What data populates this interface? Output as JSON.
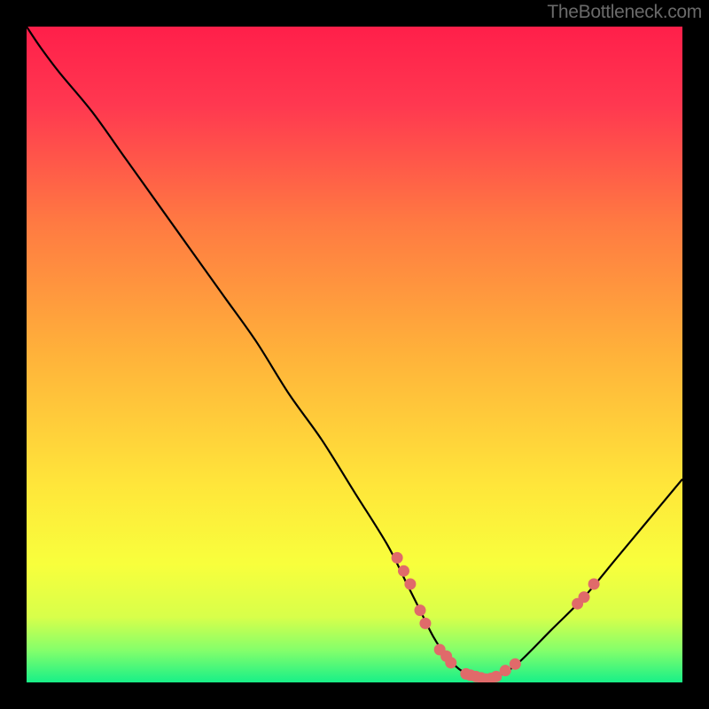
{
  "watermark": "TheBottleneck.com",
  "chart_data": {
    "type": "line",
    "title": "",
    "xlabel": "",
    "ylabel": "",
    "xlim": [
      0,
      100
    ],
    "ylim": [
      0,
      100
    ],
    "curve": {
      "x": [
        0,
        2,
        5,
        10,
        15,
        20,
        25,
        30,
        35,
        40,
        45,
        50,
        55,
        58,
        60,
        62,
        64,
        66,
        68,
        70,
        72,
        75,
        80,
        85,
        90,
        95,
        100
      ],
      "y": [
        100,
        97,
        93,
        87,
        80,
        73,
        66,
        59,
        52,
        44,
        37,
        29,
        21,
        15,
        11,
        7,
        4,
        2,
        1,
        0.5,
        1,
        3,
        8,
        13,
        19,
        25,
        31
      ]
    },
    "highlight_points": [
      {
        "x": 56.5,
        "y": 19
      },
      {
        "x": 57.5,
        "y": 17
      },
      {
        "x": 58.5,
        "y": 15
      },
      {
        "x": 60.0,
        "y": 11
      },
      {
        "x": 60.8,
        "y": 9
      },
      {
        "x": 63.0,
        "y": 5
      },
      {
        "x": 64.0,
        "y": 4
      },
      {
        "x": 64.7,
        "y": 3
      },
      {
        "x": 67.0,
        "y": 1.3
      },
      {
        "x": 67.7,
        "y": 1.1
      },
      {
        "x": 68.5,
        "y": 0.9
      },
      {
        "x": 69.3,
        "y": 0.7
      },
      {
        "x": 70.0,
        "y": 0.5
      },
      {
        "x": 70.8,
        "y": 0.6
      },
      {
        "x": 71.6,
        "y": 0.9
      },
      {
        "x": 73.0,
        "y": 1.8
      },
      {
        "x": 74.5,
        "y": 2.8
      },
      {
        "x": 84.0,
        "y": 12
      },
      {
        "x": 85.0,
        "y": 13
      },
      {
        "x": 86.5,
        "y": 15
      }
    ],
    "gradient_stops": [
      {
        "offset": 0.0,
        "color": "#ff1f4a"
      },
      {
        "offset": 0.12,
        "color": "#ff3850"
      },
      {
        "offset": 0.3,
        "color": "#ff7a42"
      },
      {
        "offset": 0.5,
        "color": "#ffb23a"
      },
      {
        "offset": 0.7,
        "color": "#ffe63a"
      },
      {
        "offset": 0.82,
        "color": "#f8ff3c"
      },
      {
        "offset": 0.9,
        "color": "#d8ff4a"
      },
      {
        "offset": 0.95,
        "color": "#86ff6a"
      },
      {
        "offset": 1.0,
        "color": "#18f088"
      }
    ],
    "marker_color": "#e06a6a",
    "curve_color": "#000000"
  }
}
